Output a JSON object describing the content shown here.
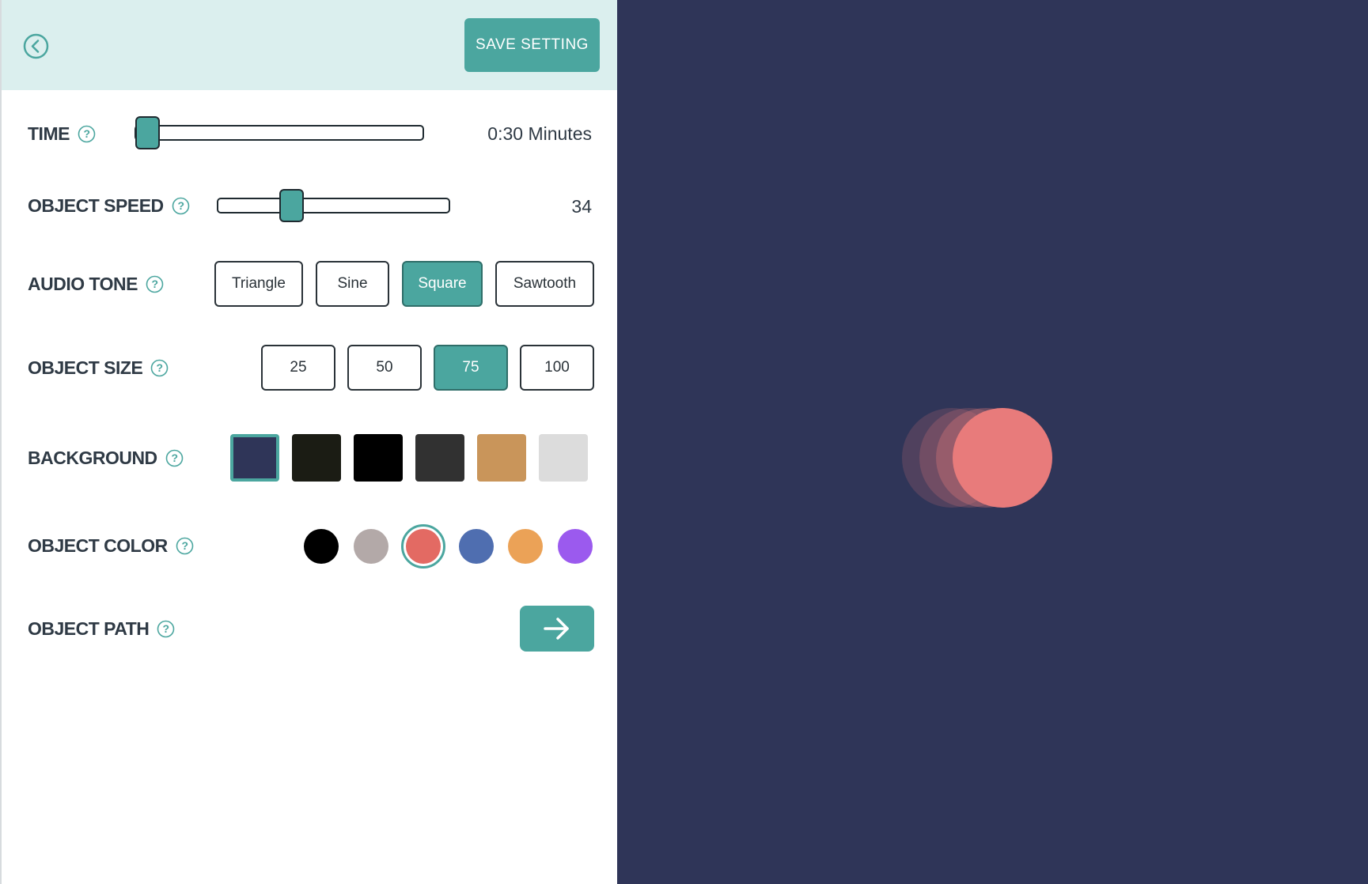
{
  "header": {
    "back_icon": "chevron-left-circle-icon",
    "save_label": "SAVE SETTING"
  },
  "time": {
    "label": "TIME",
    "value_text": "0:30 Minutes",
    "slider_fraction": 0.0
  },
  "speed": {
    "label": "OBJECT SPEED",
    "value_text": "34",
    "slider_fraction": 0.3
  },
  "audio_tone": {
    "label": "AUDIO TONE",
    "options": [
      "Triangle",
      "Sine",
      "Square",
      "Sawtooth"
    ],
    "selected": "Square"
  },
  "object_size": {
    "label": "OBJECT SIZE",
    "options": [
      "25",
      "50",
      "75",
      "100"
    ],
    "selected": "75"
  },
  "background": {
    "label": "BACKGROUND",
    "swatches": [
      "#2f3558",
      "#1b1c14",
      "#000000",
      "#313131",
      "#c9955a",
      "#dcdcdc"
    ],
    "selected_index": 0
  },
  "object_color": {
    "label": "OBJECT COLOR",
    "colors": [
      "#000000",
      "#b3a9a8",
      "#e36a63",
      "#4f6eb0",
      "#eba257",
      "#9b5aee"
    ],
    "selected_index": 2
  },
  "object_path": {
    "label": "OBJECT PATH",
    "icon": "arrow-right-icon"
  },
  "help_icon": "question-circle-icon",
  "preview": {
    "background": "#2f3558",
    "object_color": "#e87b7b"
  }
}
